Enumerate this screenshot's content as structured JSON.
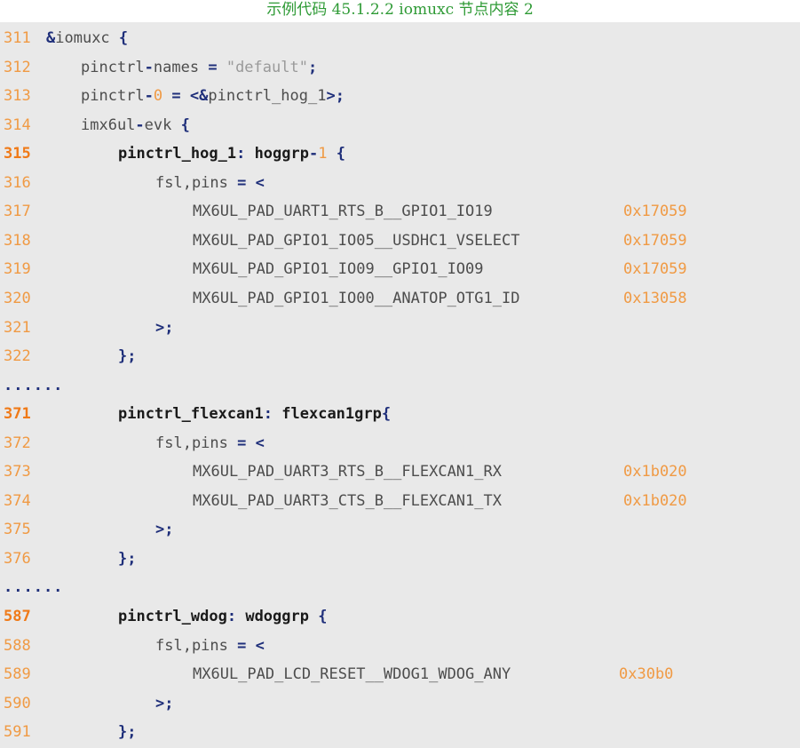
{
  "caption": "示例代码 45.1.2.2 iomuxc 节点内容 2",
  "ellipsis": "......",
  "lines": [
    {
      "num": "311",
      "highlight": false,
      "tokens": [
        {
          "t": "&",
          "c": "op"
        },
        {
          "t": "iomuxc ",
          "c": "plain"
        },
        {
          "t": "{",
          "c": "op"
        }
      ]
    },
    {
      "num": "312",
      "highlight": false,
      "tokens": [
        {
          "t": "pinctrl",
          "c": "plain"
        },
        {
          "t": "-",
          "c": "op"
        },
        {
          "t": "names ",
          "c": "plain"
        },
        {
          "t": "=",
          "c": "op"
        },
        {
          "t": " ",
          "c": "plain"
        },
        {
          "t": "\"default\"",
          "c": "str"
        },
        {
          "t": ";",
          "c": "op"
        }
      ]
    },
    {
      "num": "313",
      "highlight": false,
      "tokens": [
        {
          "t": "pinctrl",
          "c": "plain"
        },
        {
          "t": "-",
          "c": "op"
        },
        {
          "t": "0",
          "c": "num"
        },
        {
          "t": " ",
          "c": "plain"
        },
        {
          "t": "=",
          "c": "op"
        },
        {
          "t": " ",
          "c": "plain"
        },
        {
          "t": "<&",
          "c": "op"
        },
        {
          "t": "pinctrl_hog_1",
          "c": "plain"
        },
        {
          "t": ">;",
          "c": "op"
        }
      ]
    },
    {
      "num": "314",
      "highlight": false,
      "tokens": [
        {
          "t": "imx6ul",
          "c": "plain"
        },
        {
          "t": "-",
          "c": "op"
        },
        {
          "t": "evk ",
          "c": "plain"
        },
        {
          "t": "{",
          "c": "op"
        }
      ]
    },
    {
      "num": "315",
      "highlight": true,
      "tokens": [
        {
          "t": "pinctrl_hog_1",
          "c": "bold"
        },
        {
          "t": ":",
          "c": "op"
        },
        {
          "t": " ",
          "c": "plain"
        },
        {
          "t": "hoggrp",
          "c": "bold"
        },
        {
          "t": "-",
          "c": "op"
        },
        {
          "t": "1",
          "c": "num"
        },
        {
          "t": " ",
          "c": "plain"
        },
        {
          "t": "{",
          "c": "op"
        }
      ]
    },
    {
      "num": "316",
      "highlight": false,
      "tokens": [
        {
          "t": "fsl,pins ",
          "c": "plain"
        },
        {
          "t": "=",
          "c": "op"
        },
        {
          "t": " ",
          "c": "plain"
        },
        {
          "t": "<",
          "c": "op"
        }
      ]
    },
    {
      "num": "317",
      "highlight": false,
      "tokens": [
        {
          "t": "MX6UL_PAD_UART1_RTS_B__GPIO1_IO19",
          "c": "plain"
        }
      ],
      "hex": "0x17059"
    },
    {
      "num": "318",
      "highlight": false,
      "tokens": [
        {
          "t": "MX6UL_PAD_GPIO1_IO05__USDHC1_VSELECT",
          "c": "plain"
        }
      ],
      "hex": "0x17059"
    },
    {
      "num": "319",
      "highlight": false,
      "tokens": [
        {
          "t": "MX6UL_PAD_GPIO1_IO09__GPIO1_IO09",
          "c": "plain"
        }
      ],
      "hex": "0x17059"
    },
    {
      "num": "320",
      "highlight": false,
      "tokens": [
        {
          "t": "MX6UL_PAD_GPIO1_IO00__ANATOP_OTG1_ID",
          "c": "plain"
        }
      ],
      "hex": "0x13058"
    },
    {
      "num": "321",
      "highlight": false,
      "tokens": [
        {
          "t": ">;",
          "c": "op"
        }
      ]
    },
    {
      "num": "322",
      "highlight": false,
      "tokens": [
        {
          "t": "};",
          "c": "op"
        }
      ]
    },
    {
      "num": "371",
      "highlight": true,
      "tokens": [
        {
          "t": "pinctrl_flexcan1",
          "c": "bold"
        },
        {
          "t": ":",
          "c": "op"
        },
        {
          "t": " ",
          "c": "plain"
        },
        {
          "t": "flexcan1grp",
          "c": "bold"
        },
        {
          "t": "{",
          "c": "op"
        }
      ]
    },
    {
      "num": "372",
      "highlight": false,
      "tokens": [
        {
          "t": "fsl,pins ",
          "c": "plain"
        },
        {
          "t": "=",
          "c": "op"
        },
        {
          "t": " ",
          "c": "plain"
        },
        {
          "t": "<",
          "c": "op"
        }
      ]
    },
    {
      "num": "373",
      "highlight": false,
      "tokens": [
        {
          "t": "MX6UL_PAD_UART3_RTS_B__FLEXCAN1_RX",
          "c": "plain"
        }
      ],
      "hex": "0x1b020"
    },
    {
      "num": "374",
      "highlight": false,
      "tokens": [
        {
          "t": "MX6UL_PAD_UART3_CTS_B__FLEXCAN1_TX",
          "c": "plain"
        }
      ],
      "hex": "0x1b020"
    },
    {
      "num": "375",
      "highlight": false,
      "tokens": [
        {
          "t": ">;",
          "c": "op"
        }
      ]
    },
    {
      "num": "376",
      "highlight": false,
      "tokens": [
        {
          "t": "};",
          "c": "op"
        }
      ]
    },
    {
      "num": "587",
      "highlight": true,
      "tokens": [
        {
          "t": "pinctrl_wdog",
          "c": "bold"
        },
        {
          "t": ":",
          "c": "op"
        },
        {
          "t": " ",
          "c": "plain"
        },
        {
          "t": "wdoggrp",
          "c": "bold"
        },
        {
          "t": " ",
          "c": "plain"
        },
        {
          "t": "{",
          "c": "op"
        }
      ]
    },
    {
      "num": "588",
      "highlight": false,
      "tokens": [
        {
          "t": "fsl,pins ",
          "c": "plain"
        },
        {
          "t": "=",
          "c": "op"
        },
        {
          "t": " ",
          "c": "plain"
        },
        {
          "t": "<",
          "c": "op"
        }
      ]
    },
    {
      "num": "589",
      "highlight": false,
      "tokens": [
        {
          "t": "MX6UL_PAD_LCD_RESET__WDOG1_WDOG_ANY",
          "c": "plain"
        }
      ],
      "hex": "0x30b0"
    },
    {
      "num": "590",
      "highlight": false,
      "tokens": [
        {
          "t": ">;",
          "c": "op"
        }
      ]
    },
    {
      "num": "591",
      "highlight": false,
      "tokens": [
        {
          "t": "};",
          "c": "op"
        }
      ]
    }
  ]
}
